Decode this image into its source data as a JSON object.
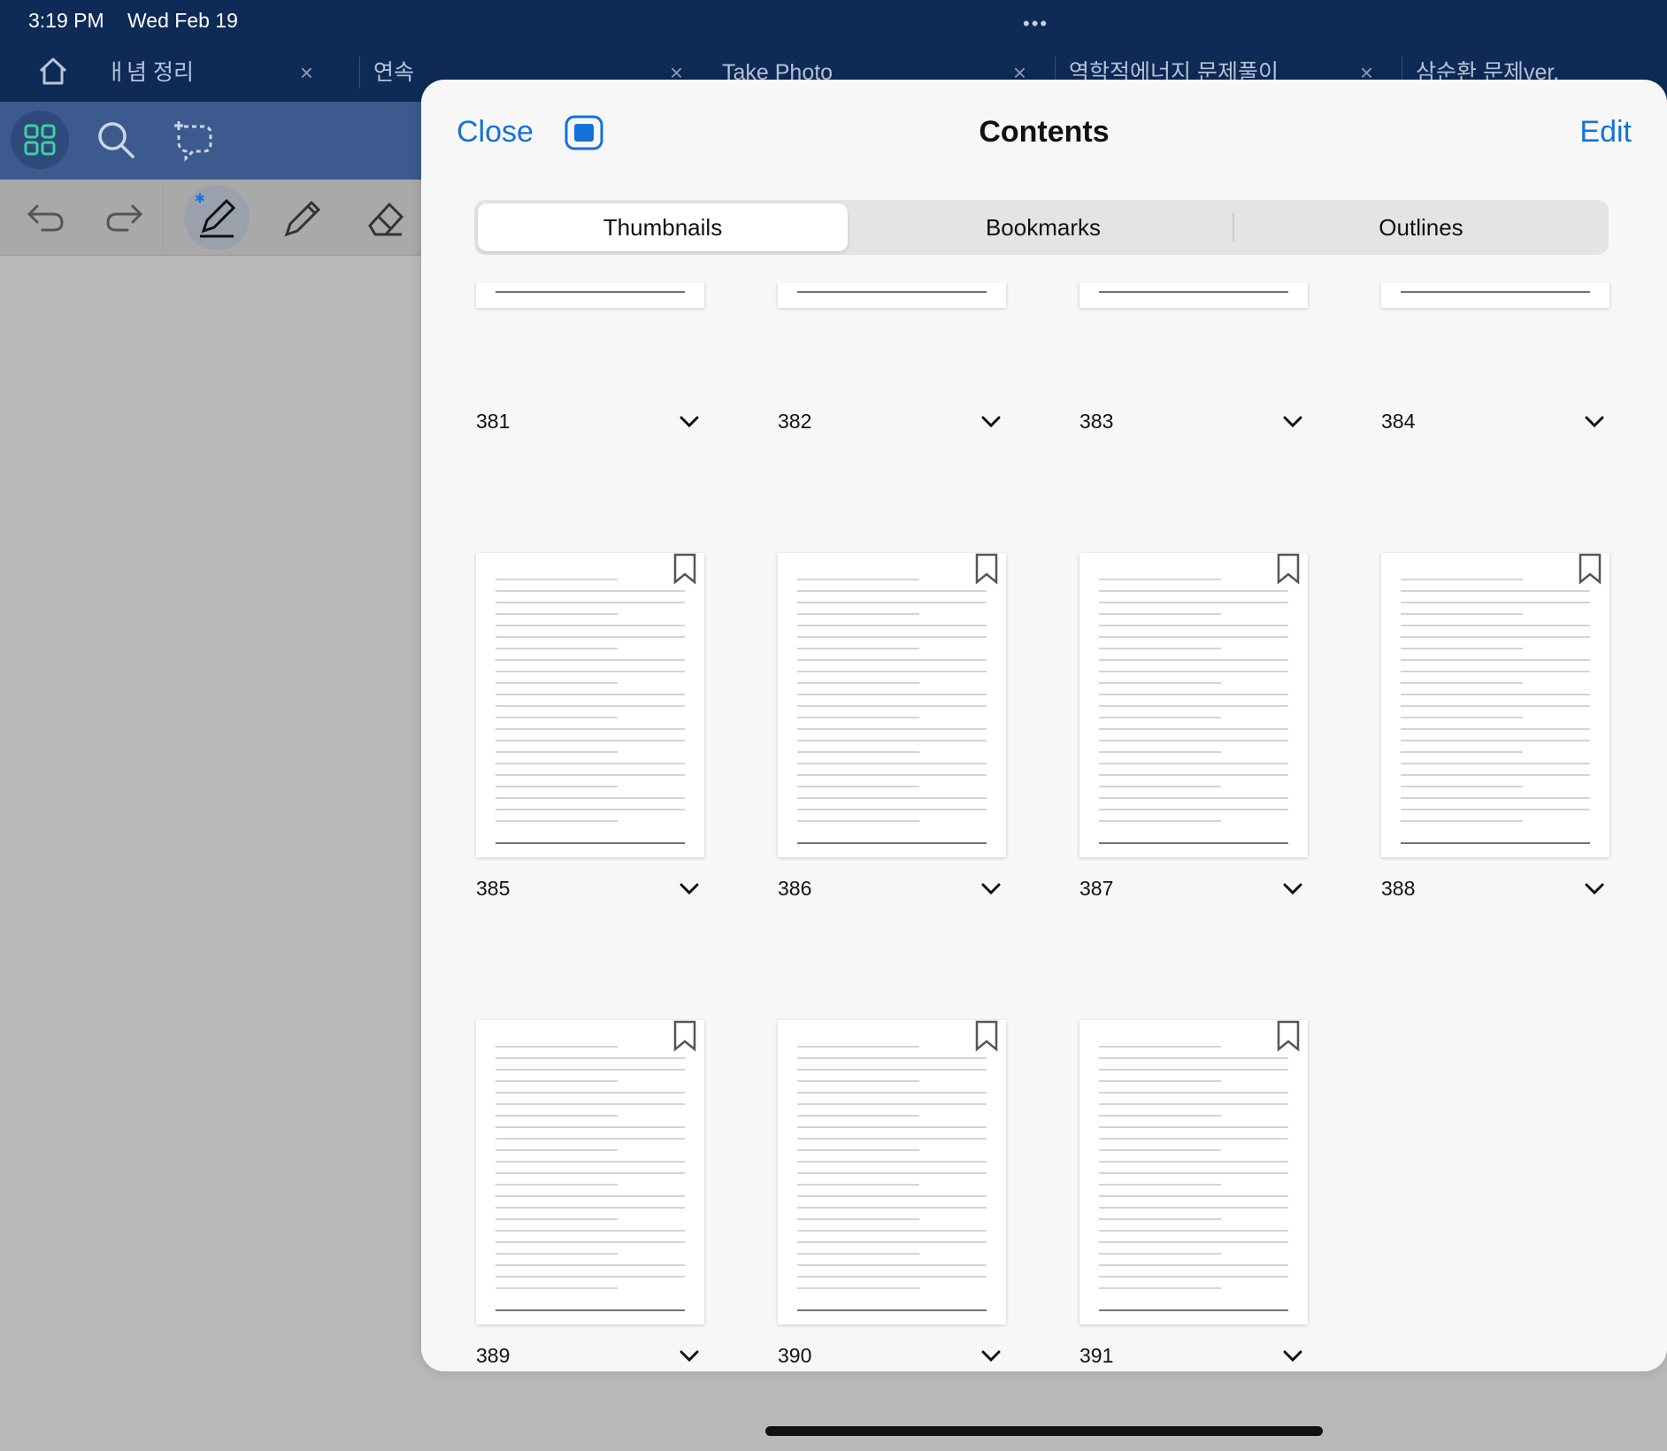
{
  "status_bar": {
    "time": "3:19 PM",
    "date": "Wed Feb 19",
    "dots": "•••"
  },
  "tabs": [
    {
      "label": "ㅐ념 정리",
      "close": "×"
    },
    {
      "label": "연속",
      "close": "×"
    },
    {
      "label": "Take Photo",
      "close": "×"
    },
    {
      "label": "역학적에너지 문제풀이",
      "close": "×"
    },
    {
      "label": "삼순환 문제ver.",
      "close": ""
    }
  ],
  "toolbar": {
    "icons": [
      "grid-icon",
      "search-icon",
      "lasso-icon",
      "undo-icon",
      "redo-icon",
      "pen-icon",
      "pencil-icon",
      "eraser-icon"
    ]
  },
  "contents": {
    "close_label": "Close",
    "title": "Contents",
    "edit_label": "Edit",
    "segments": [
      "Thumbnails",
      "Bookmarks",
      "Outlines"
    ],
    "selected_segment": "Thumbnails",
    "pages": [
      {
        "num": "381"
      },
      {
        "num": "382"
      },
      {
        "num": "383"
      },
      {
        "num": "384"
      },
      {
        "num": "385"
      },
      {
        "num": "386"
      },
      {
        "num": "387"
      },
      {
        "num": "388"
      },
      {
        "num": "389"
      },
      {
        "num": "390"
      },
      {
        "num": "391"
      }
    ]
  },
  "colors": {
    "accent": "#1472d9",
    "topbar": "#0e2a57",
    "toolbar": "#3d5a8f"
  }
}
